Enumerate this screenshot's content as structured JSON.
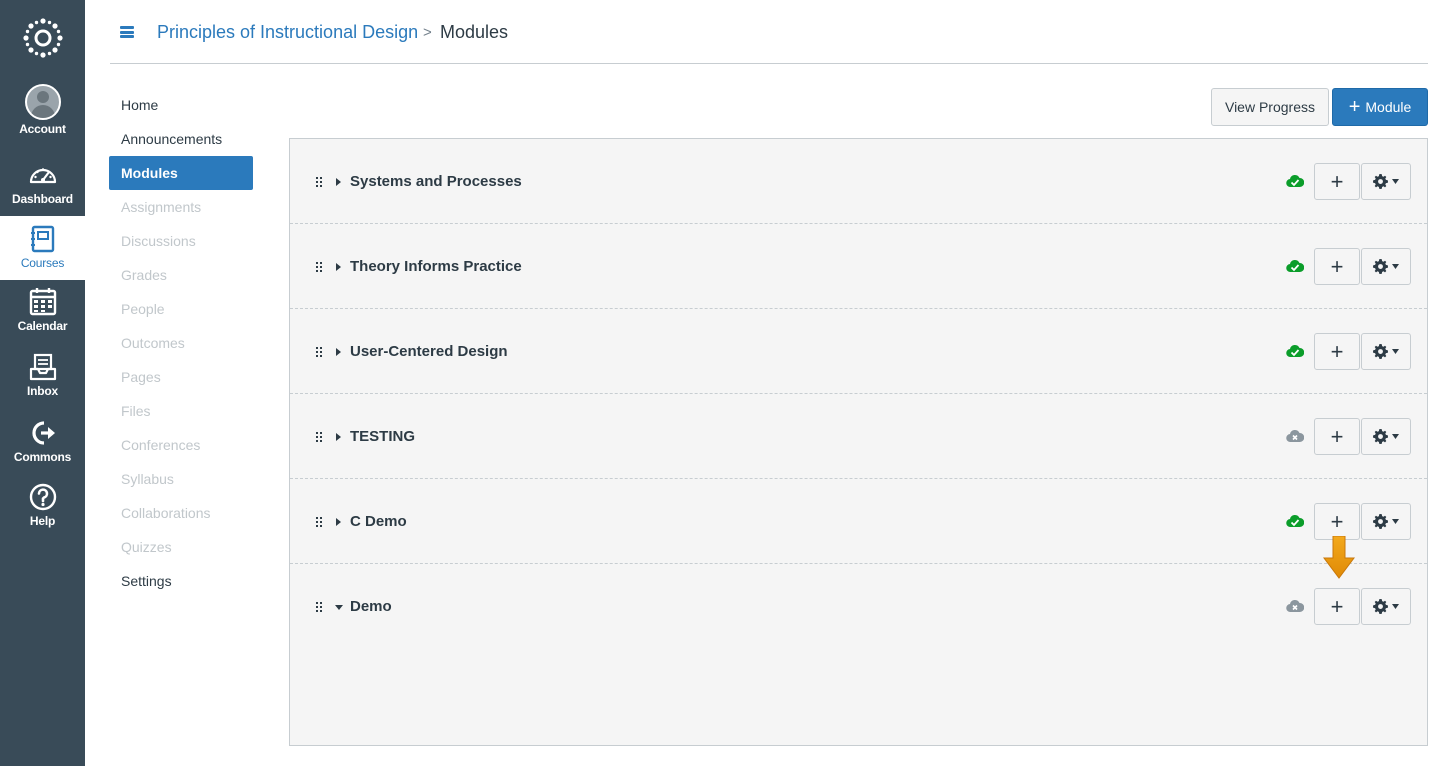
{
  "global_nav": {
    "items": [
      {
        "label": "Account",
        "icon": "avatar-icon",
        "active": false
      },
      {
        "label": "Dashboard",
        "icon": "dashboard-gauge-icon",
        "active": false
      },
      {
        "label": "Courses",
        "icon": "courses-book-icon",
        "active": true
      },
      {
        "label": "Calendar",
        "icon": "calendar-icon",
        "active": false
      },
      {
        "label": "Inbox",
        "icon": "inbox-icon",
        "active": false
      },
      {
        "label": "Commons",
        "icon": "commons-share-icon",
        "active": false
      },
      {
        "label": "Help",
        "icon": "help-question-icon",
        "active": false
      }
    ],
    "colors": {
      "background": "#394b58",
      "active_text": "#2b7abc"
    }
  },
  "header": {
    "course_title": "Principles of Instructional Design",
    "separator": ">",
    "current_page": "Modules"
  },
  "course_nav": {
    "items": [
      {
        "label": "Home",
        "state": "enabled"
      },
      {
        "label": "Announcements",
        "state": "enabled"
      },
      {
        "label": "Modules",
        "state": "active"
      },
      {
        "label": "Assignments",
        "state": "disabled"
      },
      {
        "label": "Discussions",
        "state": "disabled"
      },
      {
        "label": "Grades",
        "state": "disabled"
      },
      {
        "label": "People",
        "state": "disabled"
      },
      {
        "label": "Outcomes",
        "state": "disabled"
      },
      {
        "label": "Pages",
        "state": "disabled"
      },
      {
        "label": "Files",
        "state": "disabled"
      },
      {
        "label": "Conferences",
        "state": "disabled"
      },
      {
        "label": "Syllabus",
        "state": "disabled"
      },
      {
        "label": "Collaborations",
        "state": "disabled"
      },
      {
        "label": "Quizzes",
        "state": "disabled"
      },
      {
        "label": "Settings",
        "state": "enabled"
      }
    ]
  },
  "toolbar": {
    "view_progress_label": "View Progress",
    "add_module_plus": "+",
    "add_module_label": "Module"
  },
  "modules": [
    {
      "title": "Systems and Processes",
      "expanded": false,
      "published": true
    },
    {
      "title": "Theory Informs Practice",
      "expanded": false,
      "published": true
    },
    {
      "title": "User-Centered Design",
      "expanded": false,
      "published": true
    },
    {
      "title": "TESTING",
      "expanded": false,
      "published": false
    },
    {
      "title": "C Demo",
      "expanded": false,
      "published": true
    },
    {
      "title": "Demo",
      "expanded": true,
      "published": false
    }
  ],
  "module_row": {
    "add_item_symbol": "+"
  },
  "colors": {
    "accent": "#2b7abc",
    "published": "#0b9d2a",
    "unpublished": "#8b969e",
    "highlight_arrow": "#e8940a"
  }
}
